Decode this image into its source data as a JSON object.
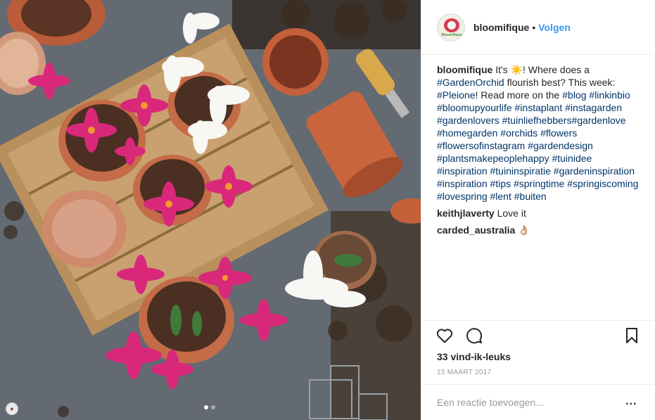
{
  "post": {
    "username": "bloomifique",
    "separator": "•",
    "follow_label": "Volgen",
    "avatar_text": "Bloomifique",
    "photo_tag_icon": "tag-icon",
    "carousel": {
      "count": 2,
      "active": 1
    }
  },
  "caption": {
    "user": "bloomifique",
    "text_1": " It's ",
    "sun": "☀️",
    "text_2": "! Where does a ",
    "tag_gardenorchid": "#GardenOrchid",
    "text_3": " flourish best? This week: ",
    "tag_pleione": "#Pleione",
    "text_4": "! Read more on the ",
    "tag_blog": "#blog",
    "hashtags": [
      "#linkinbio",
      "#bloomupyourlife",
      "#instaplant",
      "#instagarden",
      "#gardenlovers",
      "#tuinliefhebbers#gardenlove",
      "#homegarden",
      "#orchids",
      "#flowers",
      "#flowersofinstagram",
      "#gardendesign",
      "#plantsmakepeoplehappy",
      "#tuinidee",
      "#inspiration",
      "#tuininspiratie",
      "#gardeninspiration",
      "#inspiration",
      "#tips",
      "#springtime",
      "#springiscoming",
      "#lovespring",
      "#lent",
      "#buiten"
    ]
  },
  "comments": [
    {
      "user": "keithjlaverty",
      "text": " Love it"
    },
    {
      "user": "carded_australia",
      "text": " 👌🏼"
    }
  ],
  "actions": {
    "like_icon": "heart-icon",
    "comment_icon": "comment-icon",
    "save_icon": "bookmark-icon",
    "likes": "33 vind-ik-leuks",
    "date": "15 MAART 2017"
  },
  "add_comment": {
    "placeholder": "Een reactie toevoegen...",
    "more": "..."
  },
  "colors": {
    "follow": "#3897f0",
    "hashtag": "#003569",
    "text": "#262626",
    "muted": "#999999",
    "divider": "#efefef"
  }
}
